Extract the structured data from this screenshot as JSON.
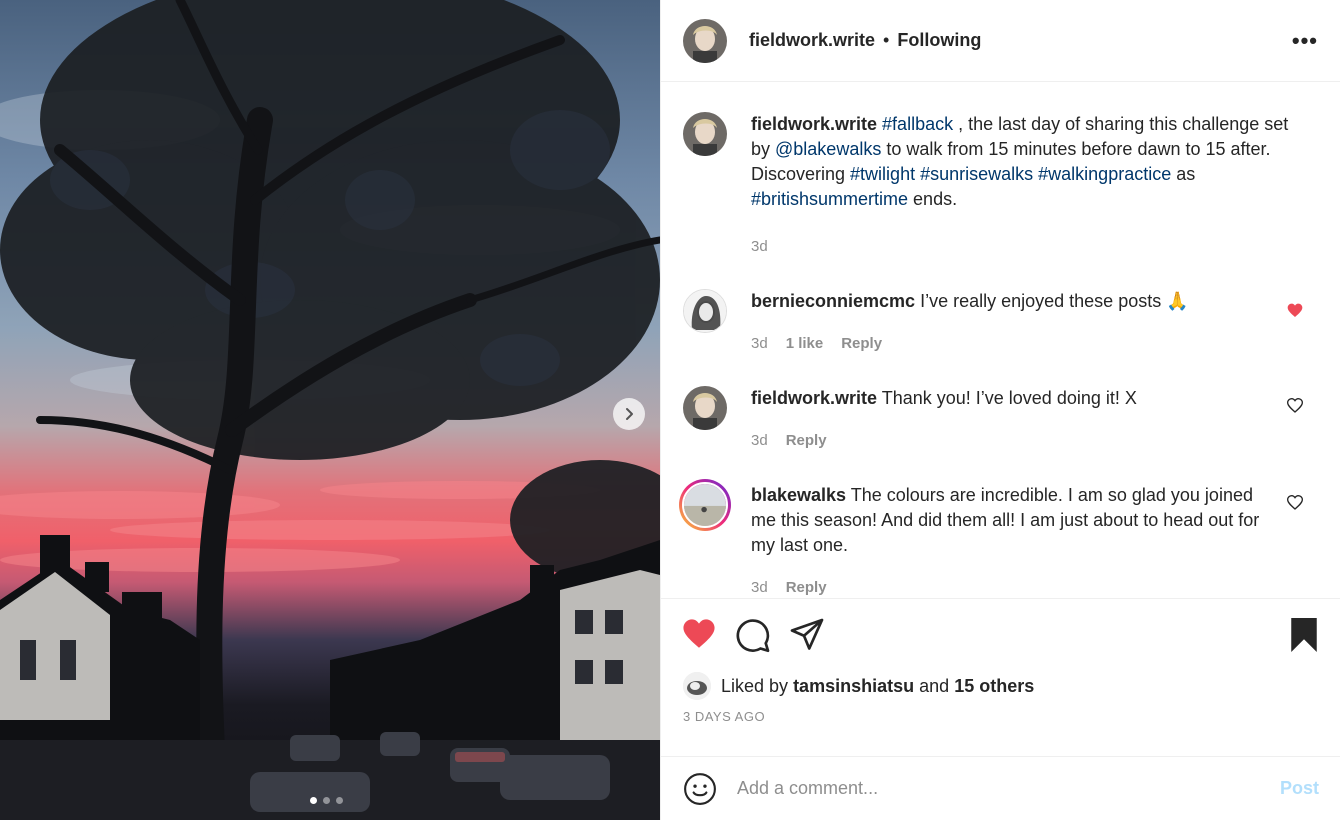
{
  "header": {
    "username": "fieldwork.write",
    "separator": "•",
    "follow_status": "Following",
    "more_label": "•••"
  },
  "caption": {
    "username": "fieldwork.write",
    "parts": [
      {
        "text": "#fallback",
        "tag": true
      },
      {
        "text": " , the last day of sharing this challenge set by ",
        "tag": false
      },
      {
        "text": "@blakewalks",
        "tag": true
      },
      {
        "text": " to walk from 15 minutes before dawn to 15 after. Discovering ",
        "tag": false
      },
      {
        "text": "#twilight",
        "tag": true
      },
      {
        "text": " ",
        "tag": false
      },
      {
        "text": "#sunrisewalks",
        "tag": true
      },
      {
        "text": " ",
        "tag": false
      },
      {
        "text": "#walkingpractice",
        "tag": true
      },
      {
        "text": " as ",
        "tag": false
      },
      {
        "text": "#britishsummertime",
        "tag": true
      },
      {
        "text": " ends.",
        "tag": false
      }
    ],
    "time": "3d"
  },
  "comments": [
    {
      "username": "bernieconniemcmc",
      "text": "I’ve really enjoyed these posts 🙏",
      "time": "3d",
      "likes": "1 like",
      "reply": "Reply",
      "liked": true
    },
    {
      "username": "fieldwork.write",
      "text": "Thank you! I’ve loved doing it! X",
      "time": "3d",
      "likes": "",
      "reply": "Reply",
      "liked": false
    },
    {
      "username": "blakewalks",
      "text": "The colours are incredible. I am so glad you joined me this season! And did them all! I am just about to head out for my last one.",
      "time": "3d",
      "likes": "",
      "reply": "Reply",
      "liked": false
    }
  ],
  "actions": {
    "liked": true,
    "likes_prefix": "Liked by",
    "liked_by_user": "tamsinshiatsu",
    "likes_and": "and",
    "likes_others": "15 others",
    "date": "3 DAYS AGO"
  },
  "add_comment": {
    "placeholder": "Add a comment...",
    "post_label": "Post"
  },
  "carousel": {
    "count": 3,
    "active": 1
  },
  "colors": {
    "like_red": "#ed4956",
    "tag_blue": "#00376b",
    "muted": "#8e8e8e",
    "post_blue": "#b2dffc"
  }
}
